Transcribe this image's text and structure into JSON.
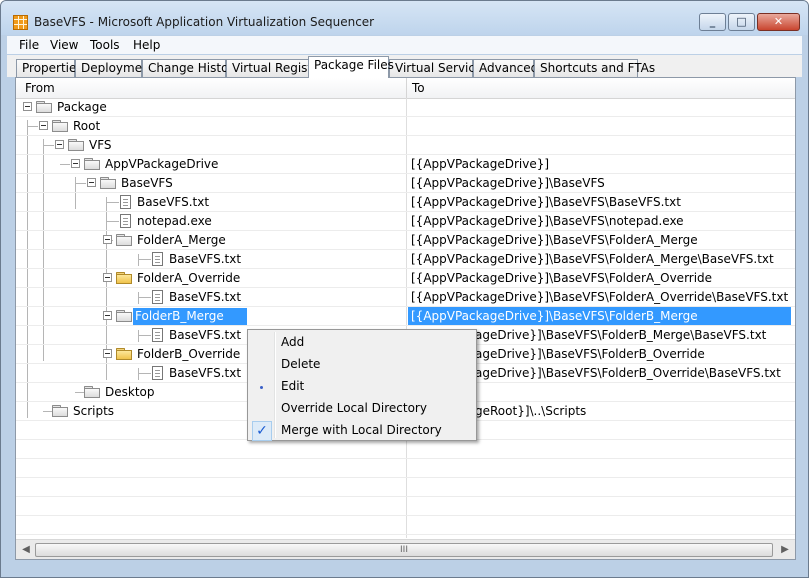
{
  "window": {
    "title": "BaseVFS - Microsoft Application Virtualization Sequencer"
  },
  "menu": [
    "File",
    "View",
    "Tools",
    "Help"
  ],
  "tabs": [
    "Properties",
    "Deployment",
    "Change History",
    "Virtual Registry",
    "Package Files",
    "Virtual Services",
    "Advanced",
    "Shortcuts and FTAs"
  ],
  "active_tab": "Package Files",
  "columns": {
    "from": "From",
    "to": "To"
  },
  "rows": [
    {
      "label": "Package",
      "to": ""
    },
    {
      "label": "Root",
      "to": ""
    },
    {
      "label": "VFS",
      "to": ""
    },
    {
      "label": "AppVPackageDrive",
      "to": "[{AppVPackageDrive}]"
    },
    {
      "label": "BaseVFS",
      "to": "[{AppVPackageDrive}]\\BaseVFS"
    },
    {
      "label": "BaseVFS.txt",
      "to": "[{AppVPackageDrive}]\\BaseVFS\\BaseVFS.txt"
    },
    {
      "label": "notepad.exe",
      "to": "[{AppVPackageDrive}]\\BaseVFS\\notepad.exe"
    },
    {
      "label": "FolderA_Merge",
      "to": "[{AppVPackageDrive}]\\BaseVFS\\FolderA_Merge"
    },
    {
      "label": "BaseVFS.txt",
      "to": "[{AppVPackageDrive}]\\BaseVFS\\FolderA_Merge\\BaseVFS.txt"
    },
    {
      "label": "FolderA_Override",
      "to": "[{AppVPackageDrive}]\\BaseVFS\\FolderA_Override"
    },
    {
      "label": "BaseVFS.txt",
      "to": "[{AppVPackageDrive}]\\BaseVFS\\FolderA_Override\\BaseVFS.txt"
    },
    {
      "label": "FolderB_Merge",
      "to": "[{AppVPackageDrive}]\\BaseVFS\\FolderB_Merge"
    },
    {
      "label": "BaseVFS.txt",
      "to": "ageDrive}]\\BaseVFS\\FolderB_Merge\\BaseVFS.txt"
    },
    {
      "label": "FolderB_Override",
      "to": "ageDrive}]\\BaseVFS\\FolderB_Override"
    },
    {
      "label": "BaseVFS.txt",
      "to": "ageDrive}]\\BaseVFS\\FolderB_Override\\BaseVFS.txt"
    },
    {
      "label": "Desktop",
      "to": ""
    },
    {
      "label": "Scripts",
      "to": "geRoot}]\\..\\Scripts"
    }
  ],
  "context_menu": {
    "items": [
      "Add",
      "Delete",
      "Edit",
      "Override Local Directory",
      "Merge with Local Directory"
    ],
    "checked": "Merge with Local Directory"
  },
  "scrollbar": {
    "left_arrow": "◀",
    "right_arrow": "▶",
    "grip": "III"
  },
  "icons": {
    "minimize": "minimize-icon",
    "maximize": "maximize-icon",
    "close": "close-icon",
    "folder": "folder-icon",
    "file": "file-icon",
    "checkmark": "checkmark-icon"
  },
  "colors": {
    "selection": "#3399ff",
    "override_folder": "#efc34c",
    "window_frame": "#bcd0e6"
  }
}
